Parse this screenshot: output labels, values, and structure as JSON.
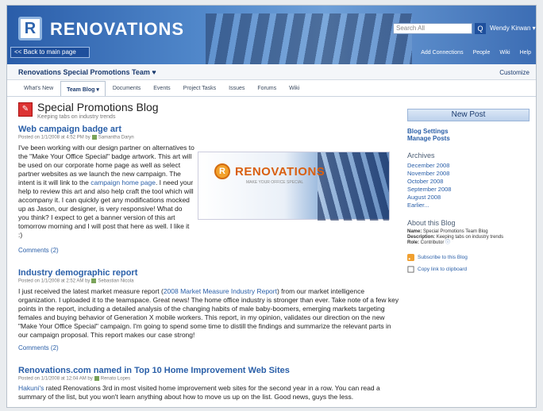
{
  "brand": {
    "name": "RENOVATIONS",
    "logo_letter": "R"
  },
  "header": {
    "search_placeholder": "Search All",
    "search_button": "Q",
    "user": "Wendy Kirwan ▾",
    "back_label": "<< Back to main page",
    "links": [
      "Add Connections",
      "People",
      "Wiki",
      "Help"
    ]
  },
  "site": {
    "title": "Renovations Special Promotions Team ♥",
    "customize": "Customize"
  },
  "nav": {
    "tabs": [
      {
        "label": "What's New",
        "active": false
      },
      {
        "label": "Team Blog ▾",
        "active": true
      },
      {
        "label": "Documents",
        "active": false
      },
      {
        "label": "Events",
        "active": false
      },
      {
        "label": "Project Tasks",
        "active": false
      },
      {
        "label": "Issues",
        "active": false
      },
      {
        "label": "Forums",
        "active": false
      },
      {
        "label": "Wiki",
        "active": false
      }
    ]
  },
  "blog": {
    "title": "Special Promotions Blog",
    "subtitle": "Keeping tabs on industry trends"
  },
  "posts": [
    {
      "title": "Web campaign badge art",
      "meta": "Posted on 1/1/2008 at 4:52 PM by",
      "author": "Samantha Daryn",
      "body_a": "I've been working with our design partner on alternatives to the \"Make Your Office Special\" badge artwork. This art will be used on our corporate home page as well as select partner websites as we launch the new campaign. The intent is it will link to the ",
      "link": "campaign home page",
      "body_b": ". I need your help to review this art and also help craft the tool which will accompany it. I can quickly get any modifications mocked up as Jason, our designer, is very responsive! What do you think? I expect to get a banner version of this art tomorrow morning and I will post that here as well. I like it :)",
      "comments": "Comments (2)"
    },
    {
      "title": "Industry demographic report",
      "meta": "Posted on 1/1/2008 at 2:52 AM by",
      "author": "Sebastian Nicola",
      "body_a": "I just received the latest market measure report (",
      "link": "2008 Market Measure Industry Report",
      "body_b": ") from our market intelligence organization. I uploaded it to the teamspace. Great news! The home office industry is stronger than ever. Take note of a few key points in the report, including a detailed analysis of the changing habits of male baby-boomers, emerging markets targeting females and buying behavior of Generation X mobile workers. This report, in my opinion, validates our direction on the new \"Make Your Office Special\" campaign. I'm going to spend some time to distill the findings and summarize the relevant parts in our campaign proposal. This report makes our case strong!",
      "comments": "Comments (2)"
    },
    {
      "title": "Renovations.com named in Top 10 Home Improvement Web Sites",
      "meta": "Posted on 1/1/2008 at 12:04 AM by",
      "author": "Renato Lopes",
      "body_a": "",
      "link": "Hakuni's",
      "body_b": " rated Renovations 3rd in most visited home improvement web sites for the second year in a row. You can read a summary of the list, but you won't learn anything about how to move us up on the list. Good news, guys the less.",
      "comments": ""
    }
  ],
  "promo": {
    "name": "RENOVATIONS",
    "tagline": "MAKE YOUR OFFICE SPECIAL",
    "logo_letter": "R"
  },
  "sidebar": {
    "new_post": "New Post",
    "settings": "Blog Settings",
    "manage": "Manage Posts",
    "archives_heading": "Archives",
    "archives": [
      "December 2008",
      "November 2008",
      "October 2008",
      "September 2008",
      "August 2008",
      "Earlier..."
    ],
    "about_heading": "About this Blog",
    "about_name_label": "Name:",
    "about_name": "Special Promotions Team Blog",
    "about_desc_label": "Description:",
    "about_desc": "Keeping tabs on industry trends",
    "about_role_label": "Role:",
    "about_role": "Contributor",
    "subscribe": "Subscribe to this Blog",
    "copy_link": "Copy link to clipboard"
  }
}
